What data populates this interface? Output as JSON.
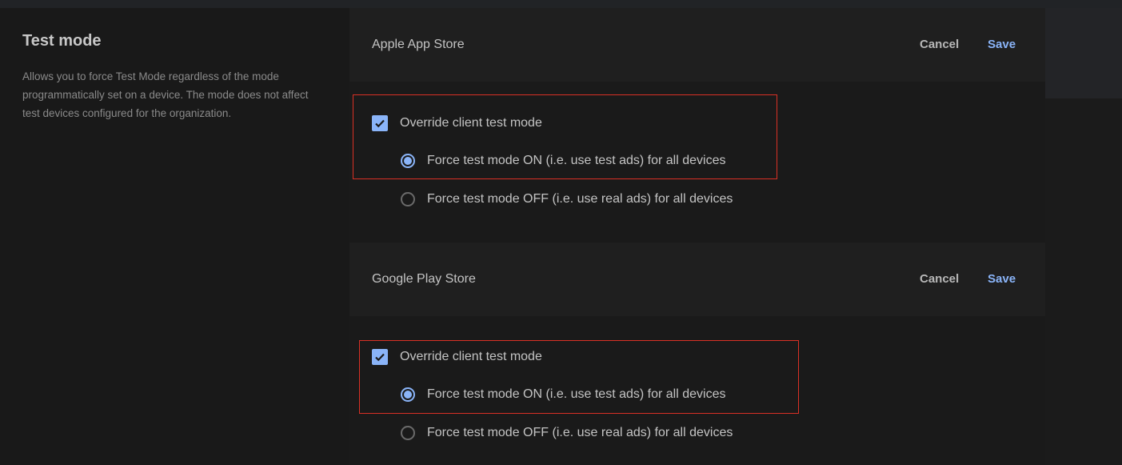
{
  "section": {
    "title": "Test mode",
    "description": "Allows you to force Test Mode regardless of the mode programmatically set on a device. The mode does not affect test devices configured for the organization."
  },
  "stores": [
    {
      "name": "Apple App Store",
      "cancel": "Cancel",
      "save": "Save",
      "override_label": "Override client test mode",
      "override_checked": true,
      "options": [
        "Force test mode ON (i.e. use test ads) for all devices",
        "Force test mode OFF (i.e. use real ads) for all devices"
      ],
      "selected": 0
    },
    {
      "name": "Google Play Store",
      "cancel": "Cancel",
      "save": "Save",
      "override_label": "Override client test mode",
      "override_checked": true,
      "options": [
        "Force test mode ON (i.e. use test ads) for all devices",
        "Force test mode OFF (i.e. use real ads) for all devices"
      ],
      "selected": 0
    }
  ],
  "colors": {
    "accent": "#8ab4f8",
    "highlight": "#d93025"
  }
}
